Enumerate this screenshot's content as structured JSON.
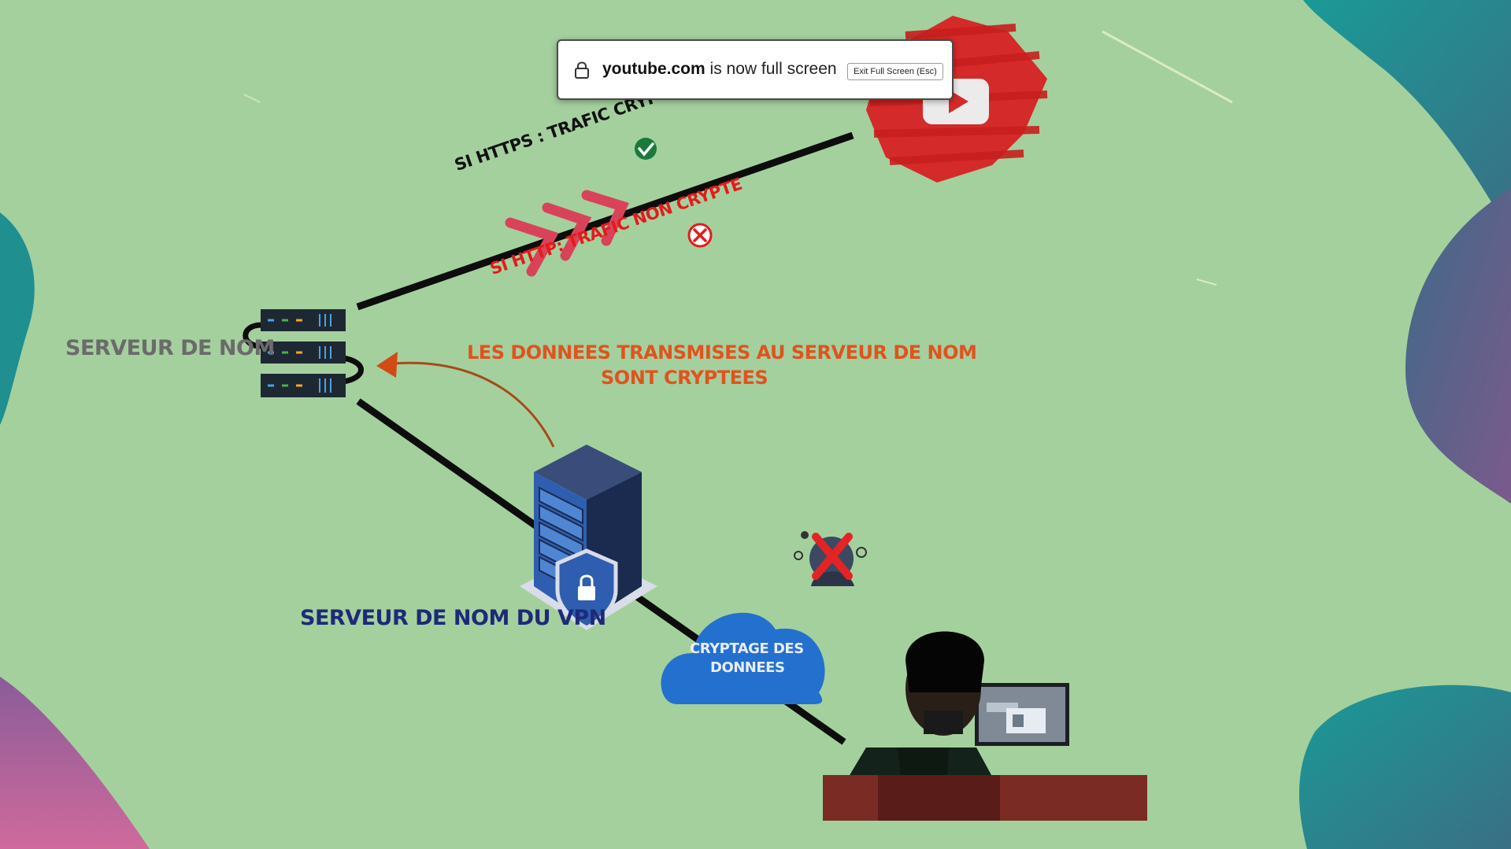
{
  "fullscreen_notice": {
    "domain": "youtube.com",
    "message": "is now full screen",
    "exit_button": "Exit Full Screen (Esc)"
  },
  "scene": {
    "name_server_label": "SERVEUR DE NOM",
    "https_label": "SI HTTPS : TRAFIC CRYPTE",
    "http_label": "SI HTTP: TRAFIC NON CRYPTE",
    "transmitted_line1": "LES DONNEES TRANSMISES AU SERVEUR DE NOM",
    "transmitted_line2": "SONT CRYPTEES",
    "vpn_server_label": "SERVEUR DE NOM DU VPN",
    "cloud_line1": "CRYPTAGE DES",
    "cloud_line2": "DONNEES"
  },
  "colors": {
    "background": "#a4d09e",
    "orange_text": "#e0531f",
    "red_text": "#e41b1b",
    "vpn_text": "#1e2a78",
    "cloud": "#2470cf",
    "chevrons": "#d9435a",
    "youtube_red": "#d42a2a"
  }
}
